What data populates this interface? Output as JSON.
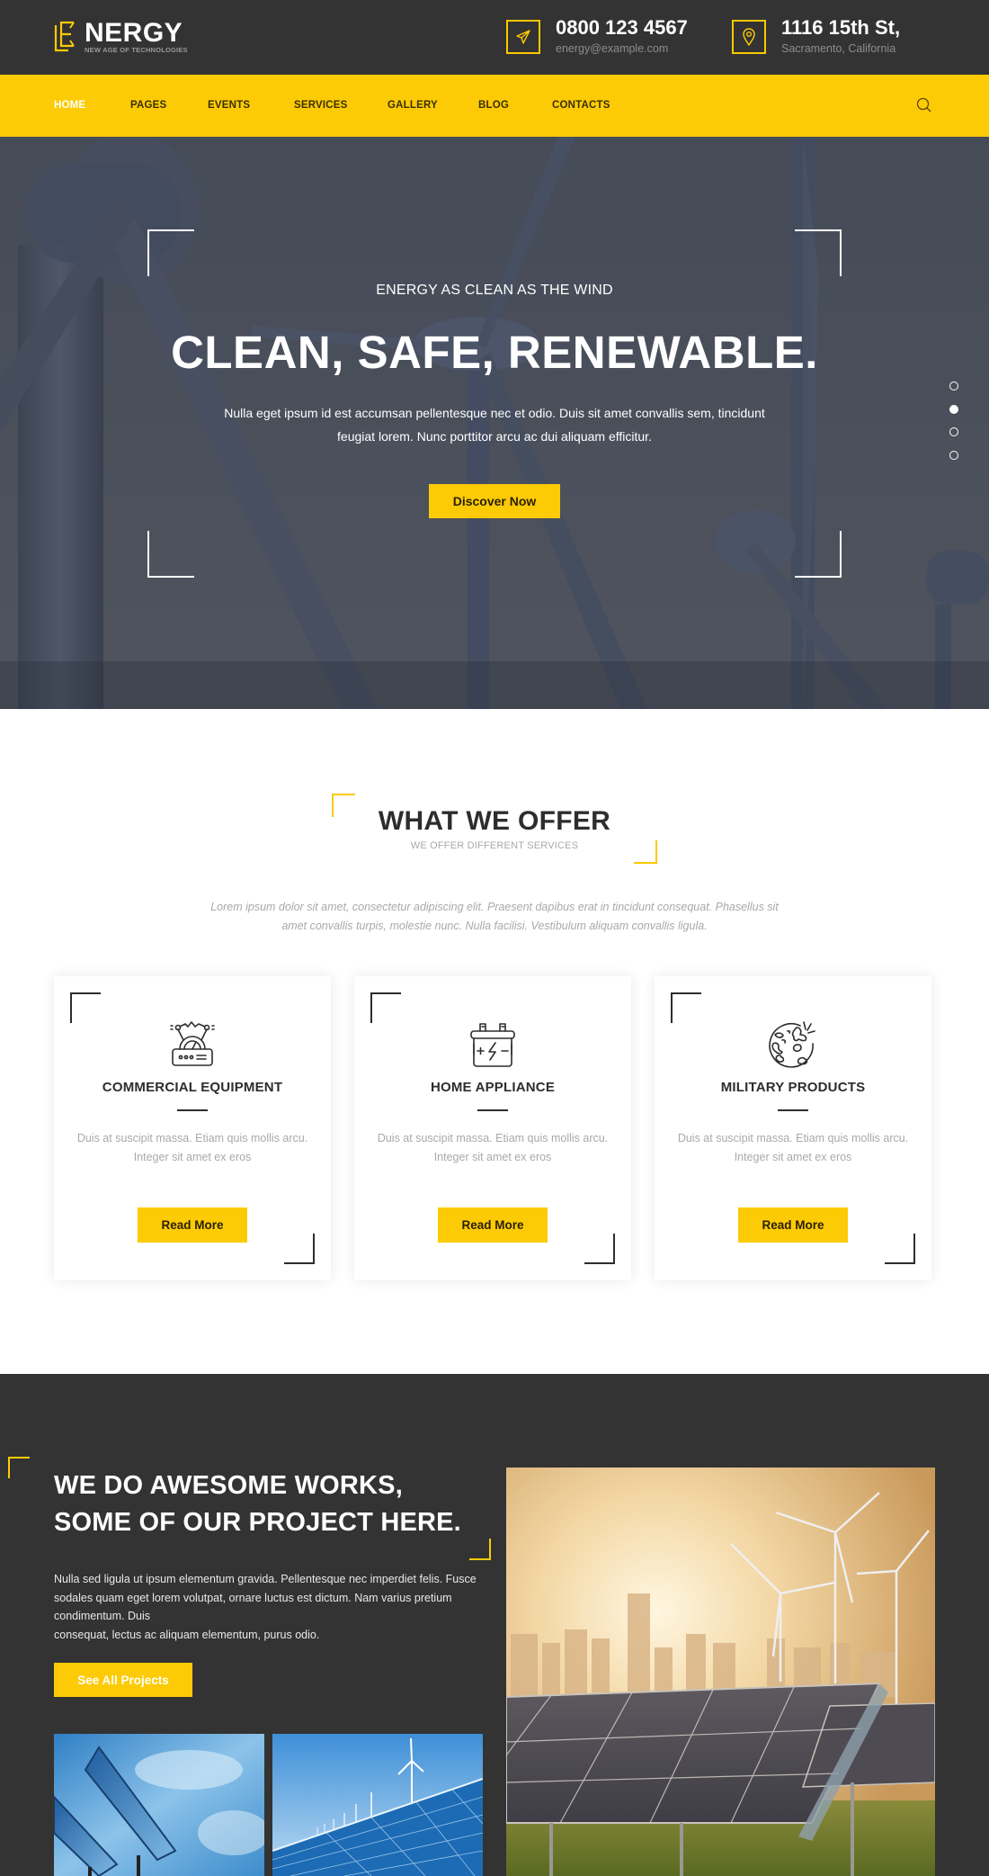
{
  "header": {
    "logo": {
      "letter_mark": "E",
      "word": "NERGY",
      "tagline": "NEW AGE OF TECHNOLOGIES"
    },
    "contacts": [
      {
        "icon": "paper-plane-icon",
        "primary": "0800 123 4567",
        "secondary": "energy@example.com"
      },
      {
        "icon": "map-pin-icon",
        "primary": "1116 15th St,",
        "secondary": "Sacramento, California"
      }
    ]
  },
  "nav": {
    "items": [
      {
        "label": "HOME",
        "active": true
      },
      {
        "label": "PAGES",
        "active": false
      },
      {
        "label": "EVENTS",
        "active": false
      },
      {
        "label": "SERVICES",
        "active": false
      },
      {
        "label": "GALLERY",
        "active": false
      },
      {
        "label": "BLOG",
        "active": false
      },
      {
        "label": "CONTACTS",
        "active": false
      }
    ],
    "search_icon": "search-icon"
  },
  "hero": {
    "kicker": "ENERGY AS CLEAN AS THE WIND",
    "title": "CLEAN, SAFE, RENEWABLE.",
    "text": "Nulla eget ipsum id est accumsan pellentesque nec et odio. Duis sit amet convallis sem, tincidunt feugiat lorem. Nunc porttitor arcu ac dui aliquam efficitur.",
    "button": "Discover Now",
    "slider": {
      "total_slides": 4,
      "active_slide": 2
    }
  },
  "offer": {
    "title": "WHAT WE OFFER",
    "subtitle": "WE OFFER DIFFERENT SERVICES",
    "intro": "Lorem ipsum dolor sit amet, consectetur adipiscing elit. Praesent dapibus erat in tincidunt consequat. Phasellus sit amet convallis turpis, molestie nunc. Nulla facilisi. Vestibulum aliquam convallis ligula.",
    "cards": [
      {
        "icon": "generator-gauge-icon",
        "title": "COMMERCIAL EQUIPMENT",
        "text": "Duis at suscipit massa. Etiam quis mollis arcu. Integer sit amet ex eros",
        "button": "Read More"
      },
      {
        "icon": "battery-icon",
        "title": "HOME APPLIANCE",
        "text": "Duis at suscipit massa. Etiam quis mollis arcu. Integer sit amet ex eros",
        "button": "Read More"
      },
      {
        "icon": "globe-explosion-icon",
        "title": "MILITARY PRODUCTS",
        "text": "Duis at suscipit massa. Etiam quis mollis arcu. Integer sit amet ex eros",
        "button": "Read More"
      }
    ]
  },
  "projects": {
    "title_line1": "WE DO AWESOME WORKS,",
    "title_line2": "SOME OF OUR PROJECT HERE.",
    "text_line1": "Nulla sed ligula ut ipsum elementum gravida. Pellentesque nec imperdiet felis. Fusce sodales quam eget lorem volutpat, ornare luctus est dictum. Nam varius pretium condimentum. Duis",
    "text_line2": "consequat, lectus ac aliquam elementum, purus odio.",
    "button": "See All Projects",
    "images": [
      {
        "subject": "solar panels against blue sky"
      },
      {
        "subject": "solar panel with wind turbines"
      },
      {
        "subject": "solar farm and wind turbines at sunset city skyline"
      }
    ]
  },
  "colors": {
    "accent": "#fccb05",
    "dark": "#333333",
    "text_muted": "#a9a9a9"
  }
}
